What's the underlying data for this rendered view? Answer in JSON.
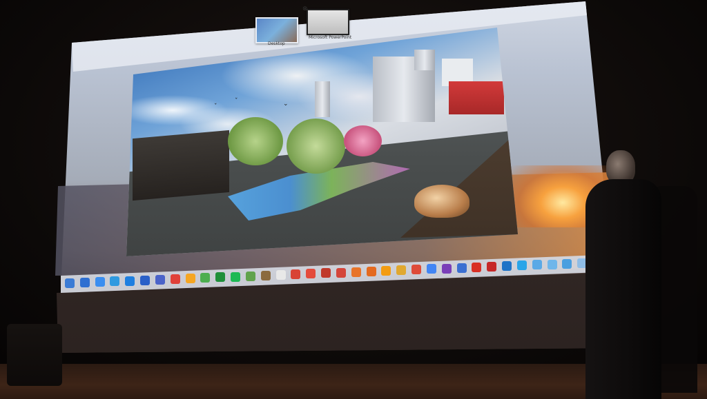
{
  "mission_control": {
    "spaces": [
      {
        "label": "Desktop"
      },
      {
        "label": "Microsoft PowerPoint"
      }
    ]
  },
  "dock": {
    "icon_colors": [
      "#3a7bd5",
      "#2f6fd1",
      "#3b8ef0",
      "#2f9ae0",
      "#1f7fe0",
      "#2a60c8",
      "#4b63c9",
      "#e0413a",
      "#f5a623",
      "#4cae4f",
      "#1f8f3a",
      "#1db954",
      "#61a34c",
      "#8b6a3e",
      "#e8e8e8",
      "#d84335",
      "#e44b3c",
      "#c0392b",
      "#d4453a",
      "#e8742a",
      "#e46a20",
      "#f39c12",
      "#e0a830",
      "#de4b39",
      "#4285f4",
      "#7a3fb8",
      "#3b6fd1",
      "#d93025",
      "#c62828",
      "#1e73c7",
      "#2aa5e8",
      "#5aa9e6",
      "#6fb6ea",
      "#4a9fe0",
      "#8fbde6",
      "#b0c8e0"
    ]
  }
}
